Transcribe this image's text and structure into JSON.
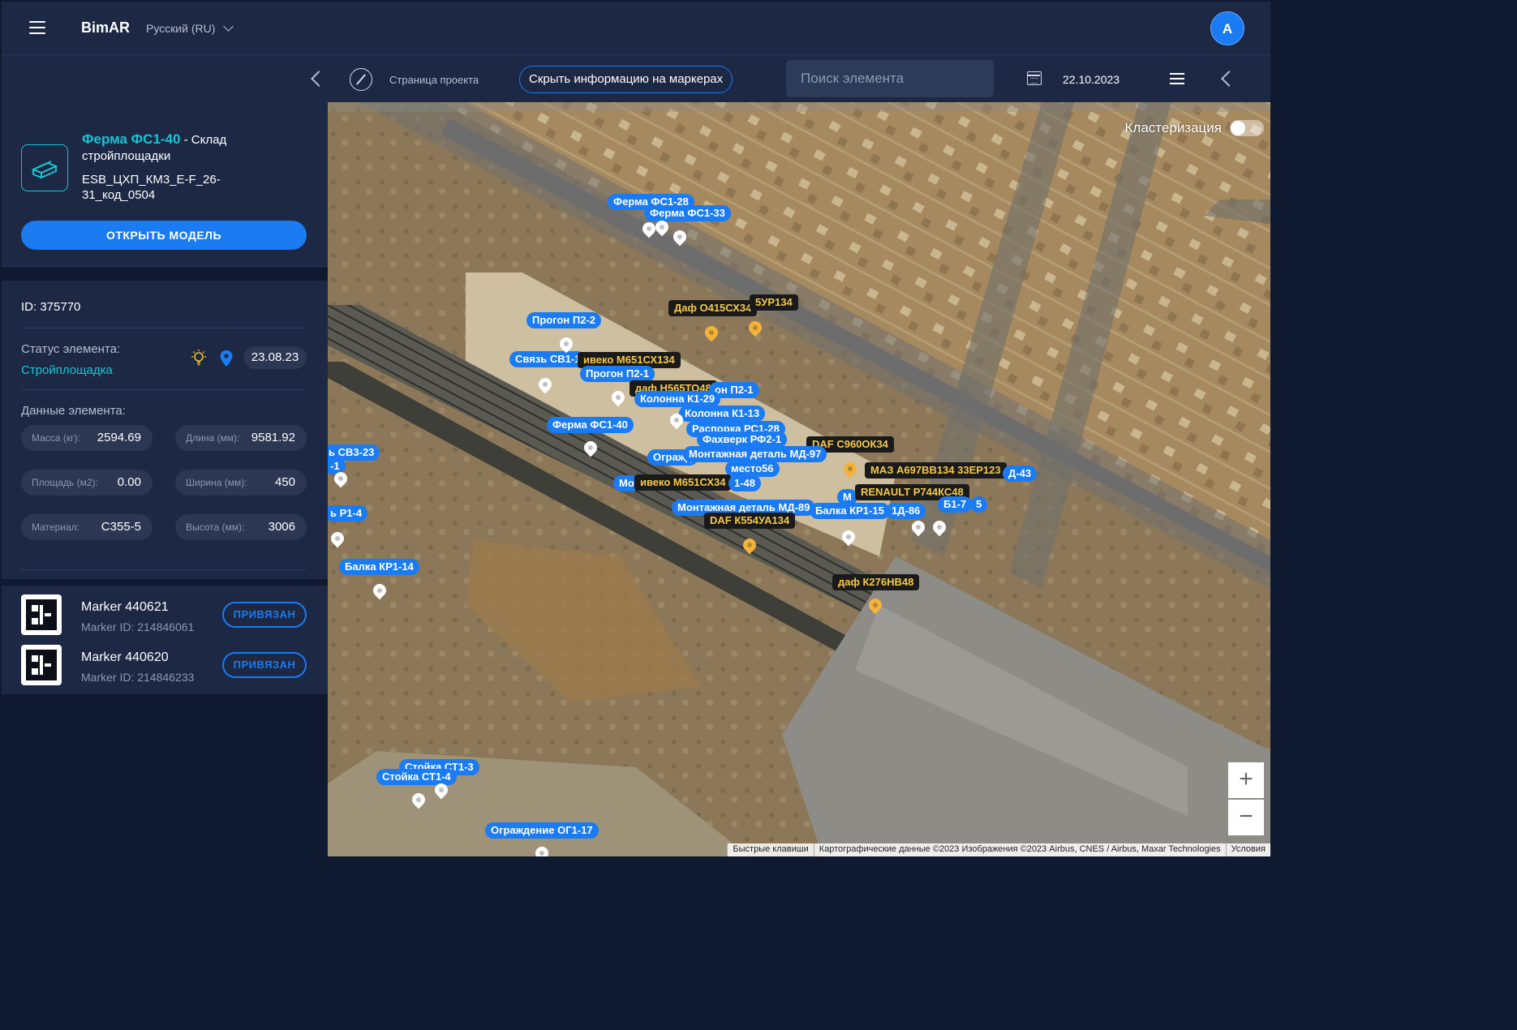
{
  "header": {
    "brand": "BimAR",
    "language": "Русский (RU)",
    "avatar_initial": "A"
  },
  "toolbar": {
    "project_page": "Страница проекта",
    "hide_marker_info": "Скрыть информацию на маркерах",
    "search_placeholder": "Поиск элемента",
    "date": "22.10.2023"
  },
  "element": {
    "name": "Ферма ФС1-40",
    "location": " - Склад стройплощадки",
    "code": "ESB_ЦХП_КМ3_E-F_26-31_код_0504",
    "open_model": "ОТКРЫТЬ МОДЕЛЬ",
    "id_line": "ID: 375770",
    "status_label": "Статус элемента:",
    "status_value": "Стройплощадка",
    "status_date": "23.08.23",
    "data_label": "Данные элемента:",
    "props": [
      {
        "key": "Масса (кг):",
        "value": "2594.69"
      },
      {
        "key": "Длина (мм):",
        "value": "9581.92"
      },
      {
        "key": "Площадь (м2):",
        "value": "0.00"
      },
      {
        "key": "Ширина (мм):",
        "value": "450"
      },
      {
        "key": "Материал:",
        "value": "С355-5"
      },
      {
        "key": "Высота (мм):",
        "value": "3006"
      }
    ]
  },
  "markers": [
    {
      "name": "Marker 440621",
      "id": "Marker ID: 214846061",
      "status": "ПРИВЯЗАН"
    },
    {
      "name": "Marker 440620",
      "id": "Marker ID: 214846233",
      "status": "ПРИВЯЗАН"
    }
  ],
  "map": {
    "clustering_label": "Кластеризация",
    "zoom_in": "+",
    "zoom_out": "−",
    "attribution": [
      "Быстрые клавиши",
      "Картографические данные ©2023 Изображения ©2023 Airbus, CNES / Airbus, Maxar Technologies",
      "Условия"
    ],
    "labels": [
      {
        "text": "Ферма ФС1-28",
        "kind": "element"
      },
      {
        "text": "Ферма ФС1-33",
        "kind": "element"
      },
      {
        "text": "Даф О415СХ34",
        "kind": "vehicle"
      },
      {
        "text": "5УР134",
        "kind": "vehicle"
      },
      {
        "text": "Прогон П2-2",
        "kind": "element"
      },
      {
        "text": "Связь СВ1-1",
        "kind": "element"
      },
      {
        "text": "ивеко М651СХ134",
        "kind": "vehicle"
      },
      {
        "text": "Прогон П2-1",
        "kind": "element"
      },
      {
        "text": "даф Н565ТО48",
        "kind": "vehicle"
      },
      {
        "text": "он П2-1",
        "kind": "element"
      },
      {
        "text": "Колонна К1-29",
        "kind": "element"
      },
      {
        "text": "Колонна К1-13",
        "kind": "element"
      },
      {
        "text": "Ферма ФС1-40",
        "kind": "element"
      },
      {
        "text": "Распорка РС1-28",
        "kind": "element"
      },
      {
        "text": "Фахверк РФ2-1",
        "kind": "element"
      },
      {
        "text": "DAF С960ОК34",
        "kind": "vehicle"
      },
      {
        "text": "ь СВ3-23",
        "kind": "element"
      },
      {
        "text": "-1",
        "kind": "element"
      },
      {
        "text": "Огражд",
        "kind": "element"
      },
      {
        "text": "Монтажная деталь МД-97",
        "kind": "element"
      },
      {
        "text": "место56",
        "kind": "element"
      },
      {
        "text": "МАЗ А697ВВ134 33ЕР123",
        "kind": "vehicle"
      },
      {
        "text": "Д-43",
        "kind": "element"
      },
      {
        "text": "Мо",
        "kind": "element"
      },
      {
        "text": "ивеко М651СХ34",
        "kind": "vehicle"
      },
      {
        "text": "1-48",
        "kind": "element"
      },
      {
        "text": "М",
        "kind": "element"
      },
      {
        "text": "RENAULT Р744КС48",
        "kind": "vehicle"
      },
      {
        "text": "ь Р1-4",
        "kind": "element"
      },
      {
        "text": "Монтажная деталь МД-89",
        "kind": "element"
      },
      {
        "text": "Балка КР1-15",
        "kind": "element"
      },
      {
        "text": "1Д-86",
        "kind": "element"
      },
      {
        "text": "Б1-7",
        "kind": "element"
      },
      {
        "text": "5",
        "kind": "element"
      },
      {
        "text": "DAF К554УА134",
        "kind": "vehicle"
      },
      {
        "text": "Балка КР1-14",
        "kind": "element"
      },
      {
        "text": "даф К276НВ48",
        "kind": "vehicle"
      },
      {
        "text": "Стойка СТ1-3",
        "kind": "element"
      },
      {
        "text": "Стойка СТ1-4",
        "kind": "element"
      },
      {
        "text": "Ограждение ОГ1-17",
        "kind": "element"
      }
    ]
  },
  "colors": {
    "accent": "#1a7bf2",
    "teal": "#17c6d4",
    "panel": "#1c2844",
    "background": "#0f1a30",
    "vehicle_label": "#f7c948"
  }
}
